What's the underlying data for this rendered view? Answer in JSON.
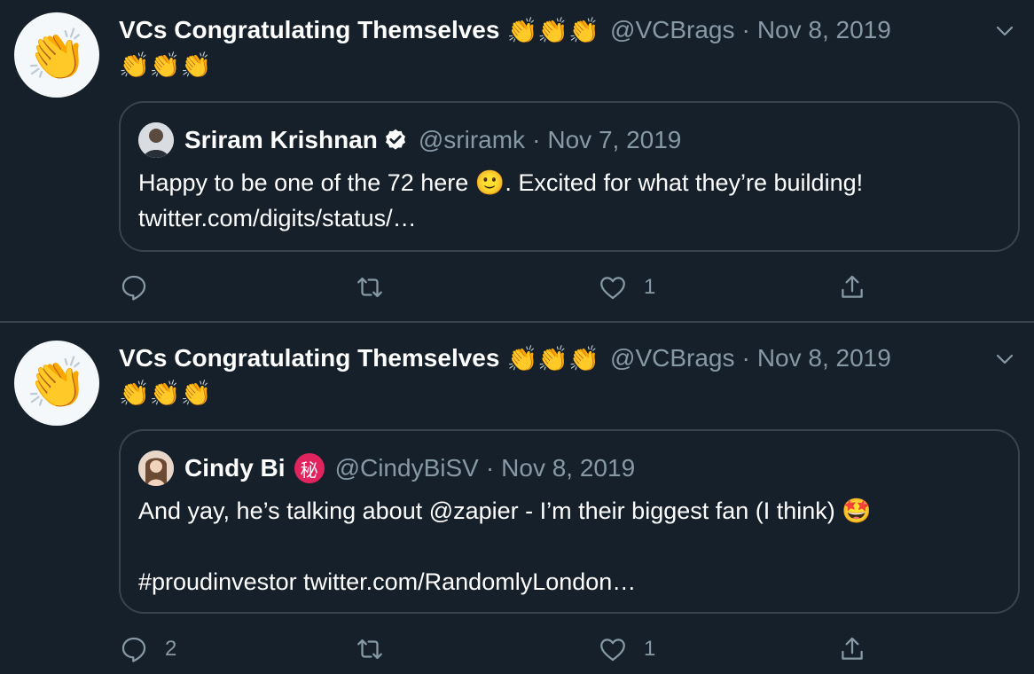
{
  "tweets": [
    {
      "author": {
        "name": "VCs Congratulating Themselves",
        "name_emojis": "👏👏👏",
        "handle": "@VCBrags",
        "avatar_icon": "clapping-hands-icon",
        "avatar_glyph": "👏"
      },
      "date": "Nov 8, 2019",
      "separator": "·",
      "text": "👏👏👏",
      "quote": {
        "author": {
          "name": "Sriram Krishnan",
          "handle": "@sriramk",
          "verified": true
        },
        "date": "Nov 7, 2019",
        "separator": "·",
        "text": "Happy to be one of the 72 here 🙂. Excited for what they’re building!\ntwitter.com/digits/status/…"
      },
      "actions": {
        "reply_count": "",
        "retweet_count": "",
        "like_count": "1"
      }
    },
    {
      "author": {
        "name": "VCs Congratulating Themselves",
        "name_emojis": "👏👏👏",
        "handle": "@VCBrags",
        "avatar_icon": "clapping-hands-icon",
        "avatar_glyph": "👏"
      },
      "date": "Nov 8, 2019",
      "separator": "·",
      "text": "👏👏👏",
      "quote": {
        "author": {
          "name": "Cindy Bi",
          "handle": "@CindyBiSV",
          "badge": "秘"
        },
        "date": "Nov 8, 2019",
        "separator": "·",
        "text": "And yay, he’s talking about @zapier - I’m their biggest fan (I think) 🤩\n\n#proudinvestor twitter.com/RandomlyLondon…"
      },
      "actions": {
        "reply_count": "2",
        "retweet_count": "",
        "like_count": "1"
      }
    }
  ],
  "colors": {
    "background": "#15202b",
    "border": "#38444d",
    "secondary_text": "#8899a6",
    "verified": "#ffffff",
    "badge": "#e0245e"
  }
}
